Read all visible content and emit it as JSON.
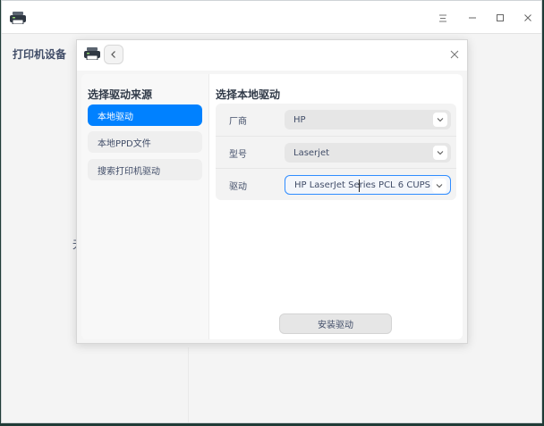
{
  "window": {
    "icons": {
      "app": "printer-icon",
      "menu": "hamburger-menu-icon",
      "minimize": "minimize-icon",
      "maximize": "maximize-icon",
      "close": "close-icon"
    }
  },
  "sidebar": {
    "title": "打印机设备"
  },
  "background": {
    "partial_text": "无"
  },
  "dialog": {
    "icons": {
      "app": "printer-icon",
      "back": "chevron-left-icon",
      "close": "close-icon"
    },
    "source_panel": {
      "title": "选择驱动来源",
      "items": [
        {
          "label": "本地驱动",
          "selected": true
        },
        {
          "label": "本地PPD文件",
          "selected": false
        },
        {
          "label": "搜索打印机驱动",
          "selected": false
        }
      ]
    },
    "driver_panel": {
      "title": "选择本地驱动",
      "fields": [
        {
          "label": "厂商",
          "value": "HP"
        },
        {
          "label": "型号",
          "value": "Laserjet"
        },
        {
          "label": "驱动",
          "value": "HP LaserJet Series PCL 6 CUPS"
        }
      ]
    },
    "install_button": {
      "label": "安装驱动"
    }
  },
  "colors": {
    "accent": "#0081ff",
    "focus_border": "#2f8cff"
  }
}
